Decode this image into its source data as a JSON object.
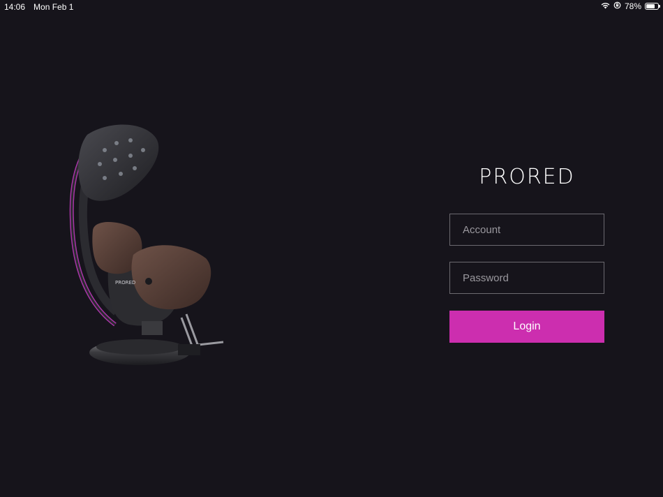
{
  "status_bar": {
    "time": "14:06",
    "date": "Mon Feb 1",
    "battery_percent": "78%",
    "battery_level": 0.78,
    "icons": [
      "wifi-icon",
      "orientation-lock-icon",
      "battery-icon"
    ]
  },
  "brand": {
    "logo_text": "PRORED",
    "accent_color": "#cc2eaf",
    "background_color": "#16141b"
  },
  "login_form": {
    "account_placeholder": "Account",
    "account_value": "",
    "password_placeholder": "Password",
    "password_value": "",
    "login_label": "Login"
  },
  "illustration": {
    "icon": "salon-chair-illustration"
  }
}
